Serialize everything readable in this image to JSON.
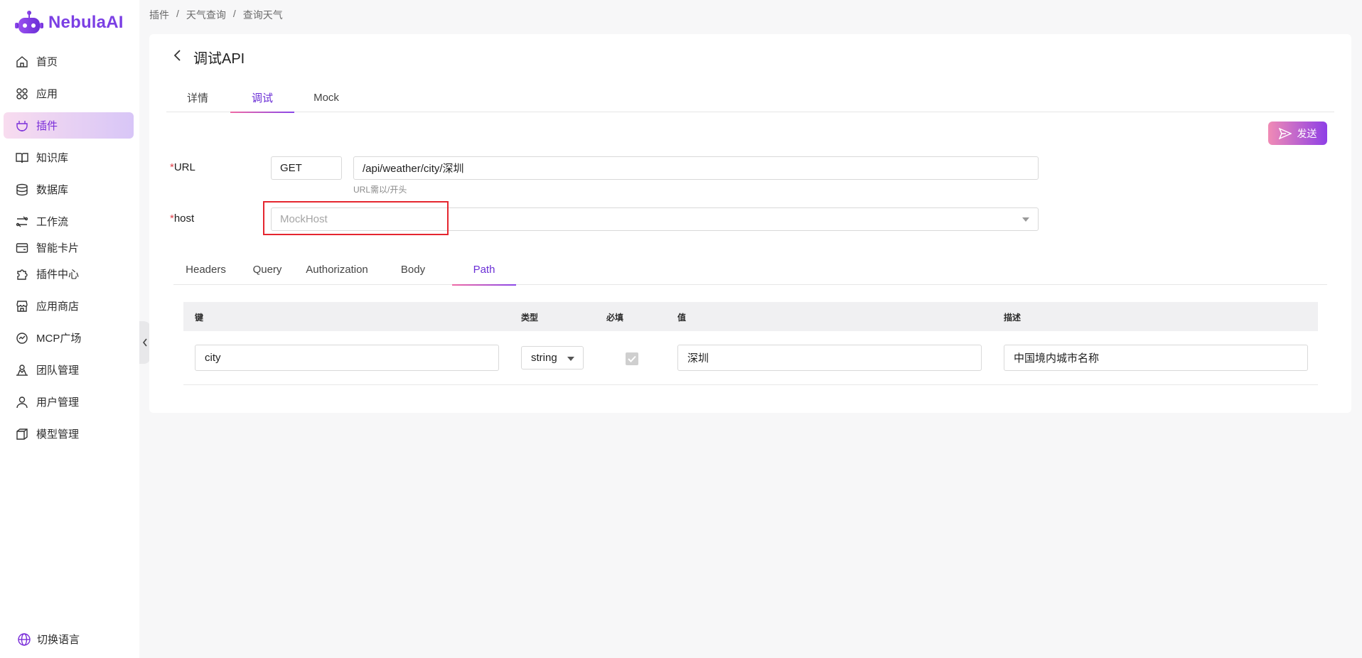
{
  "brand": {
    "name": "NebulaAI"
  },
  "sidebar": {
    "items": [
      {
        "label": "首页",
        "icon": "home-icon"
      },
      {
        "label": "应用",
        "icon": "apps-icon"
      },
      {
        "label": "插件",
        "icon": "plugin-icon"
      },
      {
        "label": "知识库",
        "icon": "book-icon"
      },
      {
        "label": "数据库",
        "icon": "database-icon"
      },
      {
        "label": "工作流",
        "icon": "workflow-icon"
      },
      {
        "label": "智能卡片",
        "icon": "card-icon"
      },
      {
        "label": "插件中心",
        "icon": "puzzle-icon"
      },
      {
        "label": "应用商店",
        "icon": "store-icon"
      },
      {
        "label": "MCP广场",
        "icon": "mcp-icon"
      },
      {
        "label": "团队管理",
        "icon": "team-icon"
      },
      {
        "label": "用户管理",
        "icon": "user-icon"
      },
      {
        "label": "模型管理",
        "icon": "model-icon"
      }
    ],
    "active_index": 2,
    "language_label": "切换语言"
  },
  "breadcrumb": [
    "插件",
    "天气查询",
    "查询天气"
  ],
  "breadcrumb_separator": "/",
  "page": {
    "title": "调试API",
    "tabs": [
      "详情",
      "调试",
      "Mock"
    ],
    "active_tab": 1,
    "send_label": "发送"
  },
  "form": {
    "url_label": "URL",
    "method": "GET",
    "url_value": "/api/weather/city/深圳",
    "url_hint": "URL需以/开头",
    "host_label": "host",
    "host_placeholder": "MockHost"
  },
  "sub_tabs": {
    "items": [
      "Headers",
      "Query",
      "Authorization",
      "Body",
      "Path"
    ],
    "active": 4
  },
  "path_table": {
    "headers": [
      "键",
      "类型",
      "必填",
      "值",
      "描述"
    ],
    "rows": [
      {
        "key": "city",
        "type": "string",
        "required": true,
        "value": "深圳",
        "description": "中国境内城市名称"
      }
    ]
  },
  "colors": {
    "accent": "#7b2fd9",
    "required_mark": "#e0424b",
    "highlight": "#e5262f"
  }
}
